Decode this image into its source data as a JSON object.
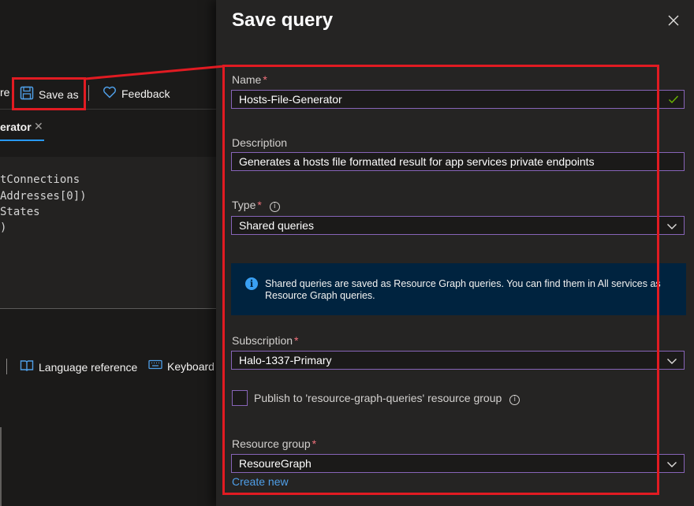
{
  "toolbar": {
    "partial_left": "re",
    "save_as_label": "Save as",
    "feedback_label": "Feedback"
  },
  "tab": {
    "label": "erator"
  },
  "code_lines": [
    "tConnections",
    "Addresses[0])",
    "States",
    ")"
  ],
  "results_toolbar": {
    "language_reference": "Language reference",
    "keyboard": "Keyboard"
  },
  "panel": {
    "title": "Save query",
    "name_label": "Name",
    "name_value": "Hosts-File-Generator",
    "description_label": "Description",
    "description_value": "Generates a hosts file formatted result for app services private endpoints",
    "type_label": "Type",
    "type_value": "Shared queries",
    "info_text": "Shared queries are saved as Resource Graph queries. You can find them in All services as Resource Graph queries.",
    "subscription_label": "Subscription",
    "subscription_value": "Halo-1337-Primary",
    "publish_label": "Publish to 'resource-graph-queries' resource group",
    "resource_group_label": "Resource group",
    "resource_group_value": "ResoureGraph",
    "create_new_label": "Create new",
    "required_marker": "*"
  },
  "colors": {
    "accent": "#8764b8",
    "highlight": "#e11b22",
    "link": "#4f9fe8",
    "info_bg": "#00233f",
    "valid": "#6bb700"
  },
  "icons": [
    "save-icon",
    "heart-icon",
    "book-icon",
    "keyboard-icon",
    "close-icon",
    "checkmark-icon",
    "chevron-down-icon",
    "info-icon"
  ]
}
